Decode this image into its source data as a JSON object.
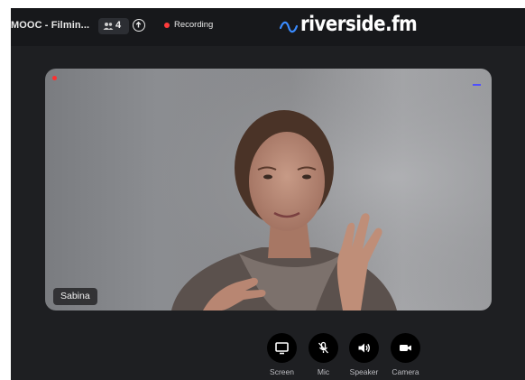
{
  "header": {
    "session_title": "MOOC - Filmin...",
    "participant_count": "4",
    "recording_label": "Recording",
    "brand": "riverside.fm"
  },
  "icons": {
    "participants": "people-icon",
    "upload": "upload-arrow-icon",
    "recording": "red-dot-icon",
    "brand_mark": "wave-logo-icon"
  },
  "video": {
    "participant_name": "Sabina",
    "recording_indicator_color": "#ff3030",
    "audio_level_color": "#4f4fff"
  },
  "controls": [
    {
      "label": "Screen",
      "icon": "monitor-icon"
    },
    {
      "label": "Mic",
      "icon": "mic-muted-icon"
    },
    {
      "label": "Speaker",
      "icon": "speaker-icon"
    },
    {
      "label": "Camera",
      "icon": "camera-icon"
    }
  ],
  "colors": {
    "app_background": "#1e1f22",
    "topbar_background": "#17181b",
    "brand_accent": "#3a8bff",
    "recording_red": "#ff3b3b"
  }
}
